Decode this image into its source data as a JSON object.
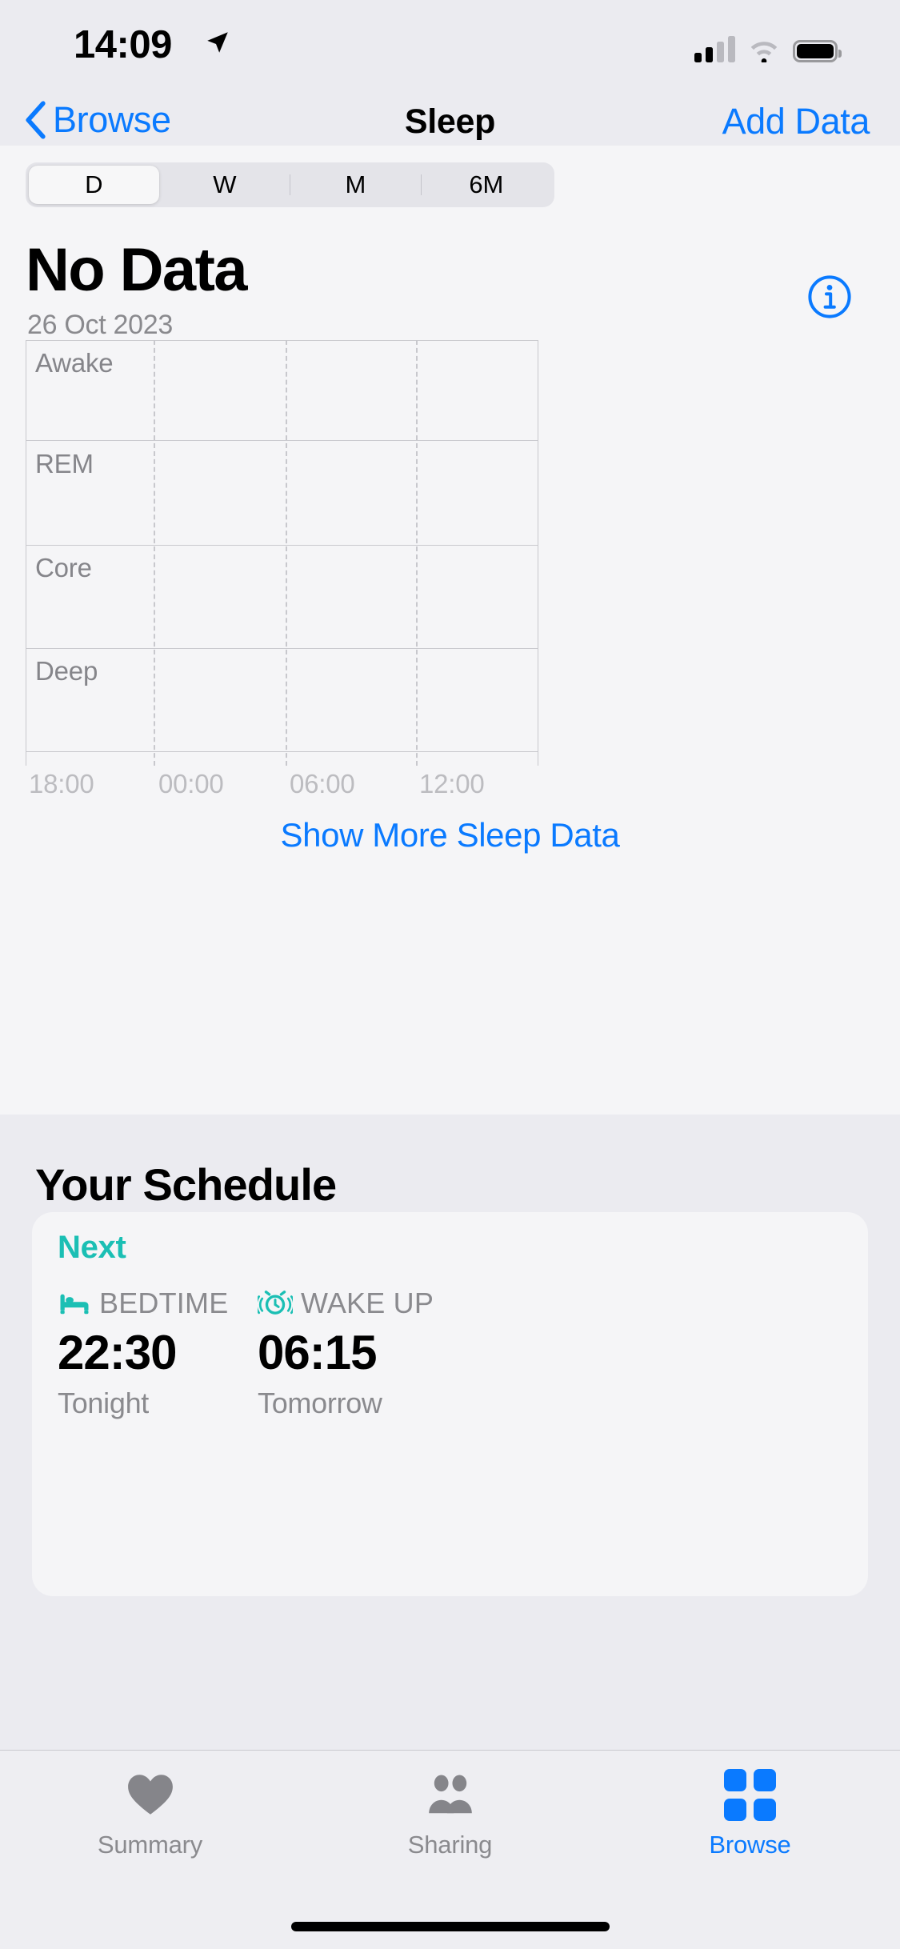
{
  "status_bar": {
    "time": "14:09",
    "location_icon": "location-arrow-icon",
    "cellular_icon": "cellular-signal-icon",
    "cellular_bars_filled": 2,
    "cellular_bars_total": 4,
    "wifi_icon": "wifi-icon",
    "battery_icon": "battery-icon",
    "battery_level": 100
  },
  "nav": {
    "back_label": "Browse",
    "title": "Sleep",
    "action_label": "Add Data"
  },
  "segmented_control": {
    "options": [
      "D",
      "W",
      "M",
      "6M"
    ],
    "selected": "D"
  },
  "summary": {
    "headline": "No Data",
    "date": "26 Oct 2023",
    "info_icon": "info-circle-icon"
  },
  "chart_data": {
    "type": "bar",
    "title": "No Data",
    "subtitle": "26 Oct 2023",
    "categories": [
      "Awake",
      "REM",
      "Core",
      "Deep"
    ],
    "values": [
      0,
      0,
      0,
      0
    ],
    "series": [
      {
        "name": "Awake",
        "values": []
      },
      {
        "name": "REM",
        "values": []
      },
      {
        "name": "Core",
        "values": []
      },
      {
        "name": "Deep",
        "values": []
      }
    ],
    "x": [
      "18:00",
      "00:00",
      "06:00",
      "12:00"
    ],
    "xlabel": "",
    "ylabel": "",
    "xticks": [
      "18:00",
      "00:00",
      "06:00",
      "12:00"
    ],
    "yticks": [
      "Awake",
      "REM",
      "Core",
      "Deep"
    ],
    "grid": true,
    "legend": "none",
    "empty_state": true
  },
  "links": {
    "show_more": "Show More Sleep Data"
  },
  "schedule": {
    "section_title": "Your Schedule",
    "badge": "Next",
    "bedtime": {
      "icon": "bed-icon",
      "label": "BEDTIME",
      "time": "22:30",
      "when": "Tonight"
    },
    "wakeup": {
      "icon": "alarm-clock-icon",
      "label": "WAKE UP",
      "time": "06:15",
      "when": "Tomorrow"
    }
  },
  "tab_bar": {
    "tabs": [
      {
        "label": "Summary",
        "icon": "heart-icon",
        "active": false
      },
      {
        "label": "Sharing",
        "icon": "people-icon",
        "active": false
      },
      {
        "label": "Browse",
        "icon": "grid-icon",
        "active": true
      }
    ]
  },
  "colors": {
    "accent_blue": "#0a7aff",
    "teal": "#1bbfb4",
    "gray_text": "#8a8a8e",
    "background": "#ebebf0",
    "card": "#f5f5f7"
  }
}
